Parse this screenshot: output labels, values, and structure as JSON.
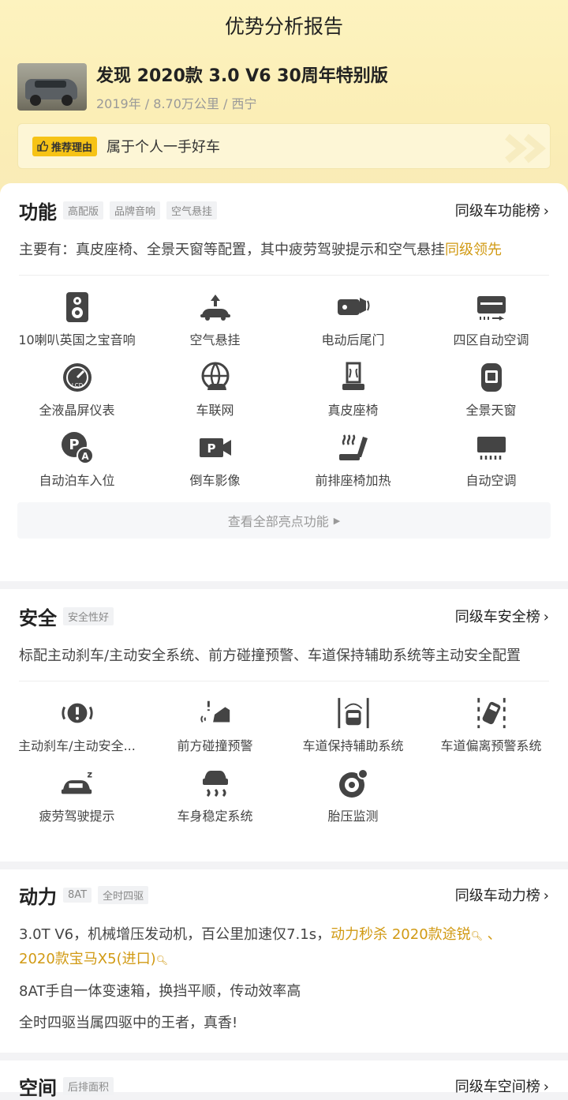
{
  "page": {
    "title": "优势分析报告"
  },
  "car": {
    "name": "发现 2020款 3.0 V6 30周年特别版",
    "meta": "2019年 / 8.70万公里 / 西宁"
  },
  "reason": {
    "tag": "推荐理由",
    "text": "属于个人一手好车"
  },
  "function": {
    "title": "功能",
    "tags": [
      "高配版",
      "品牌音响",
      "空气悬挂"
    ],
    "link": "同级车功能榜",
    "desc_main": "主要有：真皮座椅、全景天窗等配置，其中疲劳驾驶提示和空气悬挂",
    "desc_highlight": "同级领先",
    "items": [
      {
        "label": "10喇叭英国之宝音响",
        "icon": "speaker-icon"
      },
      {
        "label": "空气悬挂",
        "icon": "air-suspension-icon"
      },
      {
        "label": "电动后尾门",
        "icon": "power-tailgate-icon"
      },
      {
        "label": "四区自动空调",
        "icon": "climate-4zone-icon"
      },
      {
        "label": "全液晶屏仪表",
        "icon": "lcd-gauge-icon"
      },
      {
        "label": "车联网",
        "icon": "connected-car-icon"
      },
      {
        "label": "真皮座椅",
        "icon": "leather-seat-icon"
      },
      {
        "label": "全景天窗",
        "icon": "panoramic-roof-icon"
      },
      {
        "label": "自动泊车入位",
        "icon": "auto-park-icon"
      },
      {
        "label": "倒车影像",
        "icon": "reverse-camera-icon"
      },
      {
        "label": "前排座椅加热",
        "icon": "seat-heating-icon"
      },
      {
        "label": "自动空调",
        "icon": "auto-ac-icon"
      }
    ],
    "more": "查看全部亮点功能"
  },
  "safety": {
    "title": "安全",
    "tags": [
      "安全性好"
    ],
    "link": "同级车安全榜",
    "desc": "标配主动刹车/主动安全系统、前方碰撞预警、车道保持辅助系统等主动安全配置",
    "items": [
      {
        "label": "主动刹车/主动安全...",
        "icon": "active-brake-icon"
      },
      {
        "label": "前方碰撞预警",
        "icon": "collision-warning-icon"
      },
      {
        "label": "车道保持辅助系统",
        "icon": "lane-keep-icon"
      },
      {
        "label": "车道偏离预警系统",
        "icon": "lane-departure-icon"
      },
      {
        "label": "疲劳驾驶提示",
        "icon": "fatigue-alert-icon"
      },
      {
        "label": "车身稳定系统",
        "icon": "stability-icon"
      },
      {
        "label": "胎压监测",
        "icon": "tire-pressure-icon"
      }
    ]
  },
  "power": {
    "title": "动力",
    "tags": [
      "8AT",
      "全时四驱"
    ],
    "link": "同级车动力榜",
    "line1_main": "3.0T V6，机械增压发动机，百公里加速仅7.1s，",
    "line1_hl": "动力秒杀 2020款途锐",
    "line1_sep": " 、",
    "line1_hl2": "2020款宝马X5(进口)",
    "line2": "8AT手自一体变速箱，换挡平顺，传动效率高",
    "line3": "全时四驱当属四驱中的王者，真香!"
  },
  "space": {
    "title": "空间",
    "tags": [
      "后排面积"
    ],
    "link": "同级车空间榜"
  }
}
